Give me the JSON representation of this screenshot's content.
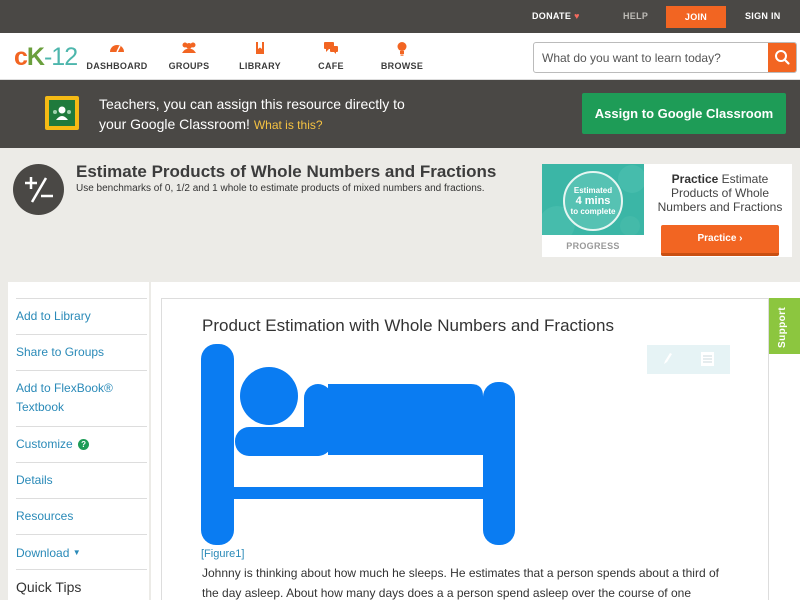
{
  "topbar": {
    "donate_label": "DONATE",
    "help_label": "HELP",
    "join_label": "JOIN",
    "signin_label": "SIGN IN"
  },
  "nav": {
    "logo_c": "c",
    "logo_k": "K",
    "logo_n": "-12",
    "items": [
      {
        "label": "DASHBOARD",
        "icon": "dashboard-icon"
      },
      {
        "label": "GROUPS",
        "icon": "groups-icon"
      },
      {
        "label": "LIBRARY",
        "icon": "library-icon"
      },
      {
        "label": "CAFE",
        "icon": "cafe-icon"
      },
      {
        "label": "BROWSE",
        "icon": "browse-icon"
      }
    ],
    "search_placeholder": "What do you want to learn today?"
  },
  "banner": {
    "line1": "Teachers, you can assign this resource directly to",
    "line2": "your Google Classroom!",
    "what_link": "What is this?",
    "assign_button": "Assign to Google Classroom"
  },
  "header": {
    "title": "Estimate Products of Whole Numbers and Fractions",
    "subtitle": "Use benchmarks of 0, 1/2 and 1 whole to estimate products of mixed numbers and fractions."
  },
  "practice": {
    "estimated": "Estimated",
    "mins": "4 mins",
    "to_complete": "to complete",
    "progress_label": "PROGRESS",
    "practice_bold": "Practice",
    "practice_text": " Estimate Products of Whole Numbers and Fractions",
    "button_label": "Practice"
  },
  "sidebar": {
    "items": [
      {
        "label": "Add to Library"
      },
      {
        "label": "Share to Groups"
      },
      {
        "label": "Add to FlexBook® Textbook"
      },
      {
        "label": "Customize"
      },
      {
        "label": "Details"
      },
      {
        "label": "Resources"
      },
      {
        "label": "Download"
      }
    ],
    "quick_tips": "Quick Tips",
    "help_badge": "?"
  },
  "content": {
    "title": "Product Estimation with Whole Numbers and Fractions",
    "figure_label": "[Figure1]",
    "body": "Johnny is thinking about how much he sleeps. He estimates that a person spends about a third of the day asleep. About how many days does a a person spend asleep over the course of one"
  },
  "support_label": "Support",
  "colors": {
    "accent_orange": "#f26522",
    "dark_bar": "#4a4845",
    "google_green": "#1e9c57",
    "link_blue": "#2a8ab8",
    "figure_blue": "#0a7cf2",
    "support_green": "#8cc63f"
  }
}
